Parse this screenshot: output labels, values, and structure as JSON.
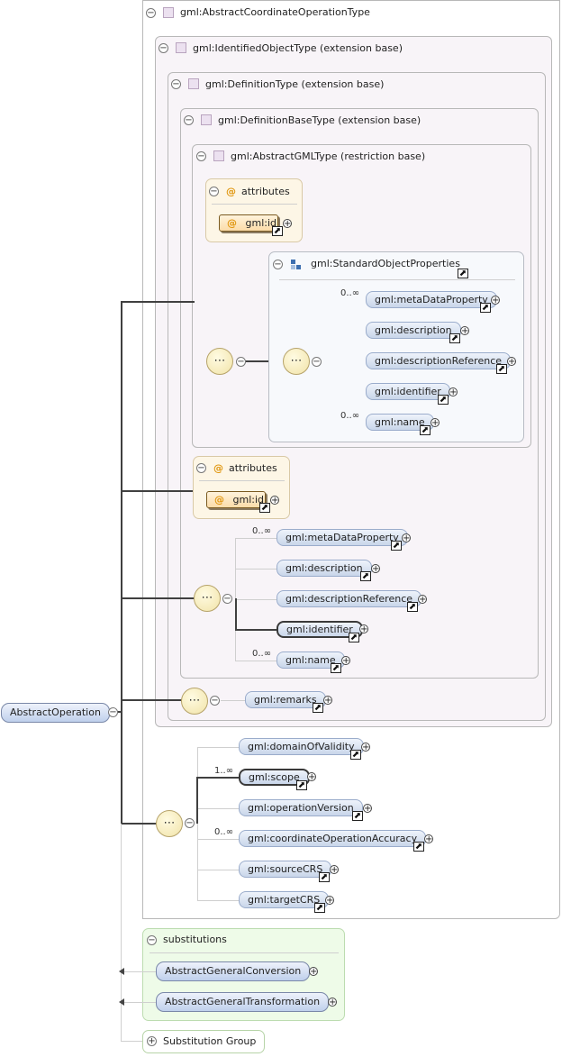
{
  "root": {
    "label": "AbstractOperation"
  },
  "complex_type": {
    "label": "gml:AbstractCoordinateOperationType"
  },
  "identified_object": {
    "label": "gml:IdentifiedObjectType (extension base)"
  },
  "definition_type": {
    "label": "gml:DefinitionType (extension base)"
  },
  "definition_base": {
    "label": "gml:DefinitionBaseType (extension base)"
  },
  "abstract_gml": {
    "label": "gml:AbstractGMLType (restriction base)"
  },
  "attributes_label": "attributes",
  "attr_symbol": "@",
  "inner_attr": {
    "label": "gml:id"
  },
  "std_props": {
    "label": "gml:StandardObjectProperties",
    "elements": [
      {
        "label": "gml:metaDataProperty",
        "occurs": "0..∞"
      },
      {
        "label": "gml:description",
        "occurs": ""
      },
      {
        "label": "gml:descriptionReference",
        "occurs": ""
      },
      {
        "label": "gml:identifier",
        "occurs": ""
      },
      {
        "label": "gml:name",
        "occurs": "0..∞"
      }
    ]
  },
  "outer_attr": {
    "label": "gml:id"
  },
  "definition_seq": [
    {
      "label": "gml:metaDataProperty",
      "occurs": "0..∞"
    },
    {
      "label": "gml:description",
      "occurs": ""
    },
    {
      "label": "gml:descriptionReference",
      "occurs": ""
    },
    {
      "label": "gml:identifier",
      "occurs": ""
    },
    {
      "label": "gml:name",
      "occurs": "0..∞"
    }
  ],
  "remarks": {
    "label": "gml:remarks"
  },
  "operation_seq": [
    {
      "label": "gml:domainOfValidity",
      "occurs": ""
    },
    {
      "label": "gml:scope",
      "occurs": "1..∞"
    },
    {
      "label": "gml:operationVersion",
      "occurs": ""
    },
    {
      "label": "gml:coordinateOperationAccuracy",
      "occurs": "0..∞"
    },
    {
      "label": "gml:sourceCRS",
      "occurs": ""
    },
    {
      "label": "gml:targetCRS",
      "occurs": ""
    }
  ],
  "substitutions": {
    "label": "substitutions",
    "items": [
      {
        "label": "AbstractGeneralConversion"
      },
      {
        "label": "AbstractGeneralTransformation"
      }
    ]
  },
  "substitution_group": {
    "label": "Substitution Group"
  },
  "symbols": {
    "collapse": "−",
    "expand": "+",
    "link": "⬈",
    "sequence": "⋯"
  }
}
